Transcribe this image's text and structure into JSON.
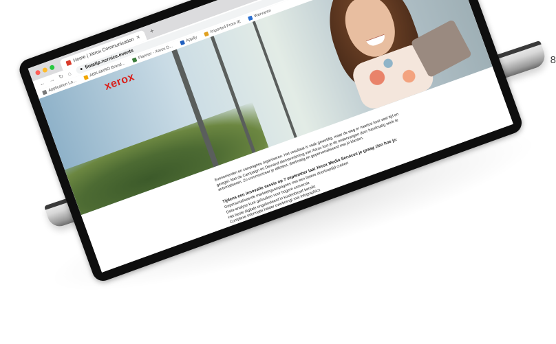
{
  "corner_digit": "8",
  "browser": {
    "traffic_colors": [
      "#ff5f57",
      "#febc2e",
      "#28c840"
    ],
    "tab": {
      "title": "Home | Xerox Communication",
      "favicon_color": "#d83a2a",
      "close_icon": "close-icon"
    },
    "new_tab_label": "+",
    "url": "flotatip.ncrnice.events",
    "bookmarks": [
      {
        "label": "Application Lo...",
        "color": "#7a7a7a"
      },
      {
        "label": "ABN AMRO Brand...",
        "color": "#f0a500"
      },
      {
        "label": "Planner - Xerox D...",
        "color": "#3a7d3a"
      },
      {
        "label": "Appify",
        "color": "#1f5fbf"
      },
      {
        "label": "Imported From IE",
        "color": "#e0a020"
      },
      {
        "label": "Wervaren",
        "color": "#2a6fd0"
      }
    ]
  },
  "site": {
    "logo": "xerox",
    "logo_color": "#d8231e",
    "intro": "Evenementen en campagnes organiseren. Het resultaat is vaak geweldig, maar de weg er naartoe kost veel tijd en geregel. Met de Campaign en Demand dienstverlening van Xerox kun je dit ondervangen door handmatig werk te automatiseren. Zo communiceer je efficiënt, doelmatig en gepersonaliseerd met je klanten.",
    "headline": "Tijdens een innovatie sessie op 7 september laat Xerox Media Services je graag zien hoe je:",
    "bullets": [
      "Gepersonaliseerde marketingcampagnes met een betere doorlooptijd creëert",
      "Data-analyse kunt gebruiken voor hogere conversie",
      "Het beste digitale ongelimiteerd in kostenbesef bereikt",
      "Complexe informatie helder overbrengt met infographics"
    ]
  }
}
